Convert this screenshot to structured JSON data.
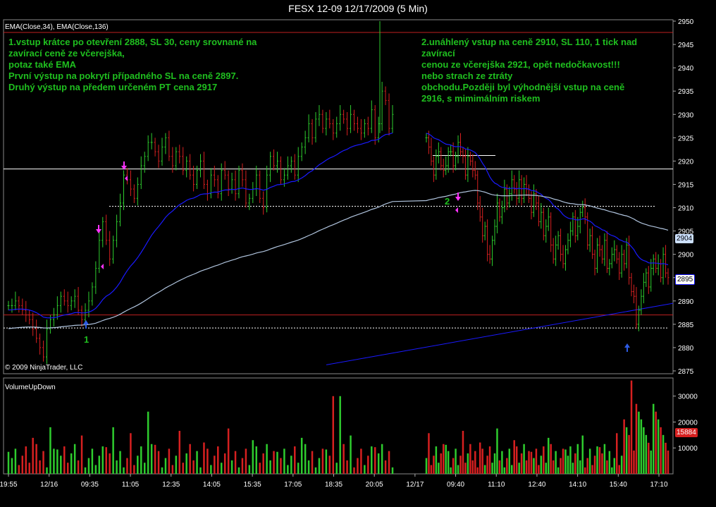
{
  "window": {
    "title": "FESX 12-09  12/17/2009 (5 Min)"
  },
  "panels": {
    "price_label": "EMA(Close,34), EMA(Close,136)",
    "volume_label": "VolumeUpDown",
    "copyright": "© 2009 NinjaTrader, LLC"
  },
  "annotations": {
    "left_text": "1.vstup krátce po otevření 2888, SL 30, ceny srovnané na\nzavírací ceně ze včerejška,\npotaz také EMA\nPrvní výstup na pokrytí případného SL na ceně 2897.\nDruhý výstup na předem určeném PT cena 2917",
    "right_text": "2.unáhlený vstup na ceně 2910, SL 110, 1 tick nad zavírací\ncenou ze včerejška 2921,  opět nedočkavost!!!\nnebo strach ze ztráty\nobchodu.Později byl výhodnější vstup na ceně\n2916, s mimimálním riskem",
    "marker_1": "1",
    "marker_2": "2"
  },
  "price_boxes": {
    "ema_fast": "2904",
    "last": "2895",
    "volume_last": "15884"
  },
  "colors": {
    "up": "#2ecc2e",
    "down": "#d62020",
    "ema34": "#1a1aff",
    "ema136": "#b0c4de",
    "annotation": "#1fbf1f",
    "arrow_up": "#2d5be3",
    "arrow_down": "#ff33ff"
  },
  "chart_data": [
    {
      "type": "candlestick",
      "title": "FESX 12-09  12/17/2009 (5 Min)",
      "ylim": [
        2875,
        2950
      ],
      "y_ticks": [
        2875,
        2880,
        2885,
        2890,
        2895,
        2900,
        2905,
        2910,
        2915,
        2920,
        2925,
        2930,
        2935,
        2940,
        2945,
        2950
      ],
      "x_ticks": [
        "19:55",
        "12/16",
        "09:35",
        "11:05",
        "12:35",
        "14:05",
        "15:35",
        "17:05",
        "18:35",
        "20:05",
        "12/17",
        "09:40",
        "11:10",
        "12:40",
        "14:10",
        "15:40",
        "17:10"
      ],
      "session1_close": [
        2889,
        2889,
        2890,
        2889,
        2888,
        2887,
        2886,
        2884,
        2882,
        2880,
        2878,
        2884,
        2886,
        2887,
        2889,
        2891,
        2890,
        2889,
        2890,
        2891,
        2888,
        2886,
        2888,
        2890,
        2893,
        2897,
        2903,
        2907,
        2903,
        2899,
        2903,
        2907,
        2911,
        2917,
        2916,
        2914,
        2912,
        2915,
        2919,
        2921,
        2924,
        2924,
        2922,
        2920,
        2923,
        2925,
        2921,
        2919,
        2922,
        2921,
        2918,
        2920,
        2917,
        2915,
        2918,
        2920,
        2915,
        2913,
        2917,
        2916,
        2913,
        2918,
        2917,
        2914,
        2916,
        2913,
        2918,
        2916,
        2911,
        2912,
        2914,
        2917,
        2912,
        2910,
        2917,
        2921,
        2919,
        2920,
        2916,
        2917,
        2919,
        2920,
        2917,
        2921,
        2923,
        2925,
        2928,
        2925,
        2929,
        2930,
        2927,
        2929,
        2928,
        2926,
        2928,
        2930,
        2929,
        2927,
        2930,
        2928,
        2927,
        2926,
        2928,
        2927,
        2931,
        2925,
        2928,
        2935,
        2933,
        2927,
        2930
      ],
      "session2_close": [
        2925,
        2923,
        2920,
        2917,
        2921,
        2922,
        2919,
        2918,
        2919,
        2922,
        2922,
        2919,
        2921,
        2924,
        2922,
        2921,
        2917,
        2921,
        2920,
        2918,
        2917,
        2911,
        2908,
        2904,
        2906,
        2900,
        2899,
        2903,
        2906,
        2911,
        2908,
        2910,
        2914,
        2911,
        2913,
        2916,
        2914,
        2912,
        2916,
        2912,
        2915,
        2914,
        2912,
        2909,
        2913,
        2911,
        2907,
        2909,
        2904,
        2906,
        2908,
        2902,
        2899,
        2902,
        2904,
        2900,
        2898,
        2901,
        2903,
        2905,
        2908,
        2904,
        2906,
        2909,
        2910,
        2908,
        2902,
        2904,
        2900,
        2897,
        2902,
        2901,
        2899,
        2903,
        2897,
        2898,
        2900,
        2901,
        2899,
        2896,
        2900,
        2898,
        2902,
        2895,
        2892,
        2891,
        2885,
        2888,
        2891,
        2894,
        2896,
        2893,
        2897,
        2899,
        2897,
        2898,
        2895,
        2900,
        2896,
        2895
      ],
      "ema34_session1_start": 2888,
      "ema136_start": 2884
    },
    {
      "type": "bar",
      "title": "VolumeUpDown",
      "ylim": [
        0,
        37000
      ],
      "y_ticks": [
        10000,
        20000,
        30000
      ],
      "last_value": 15884
    }
  ]
}
